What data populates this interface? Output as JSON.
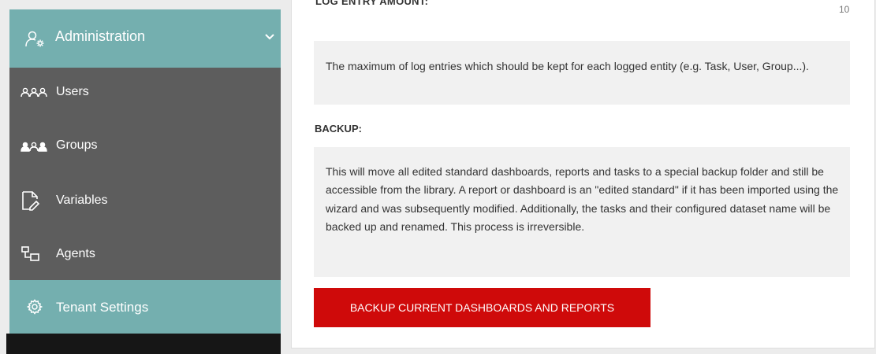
{
  "sidebar": {
    "admin": {
      "label": "Administration",
      "icon": "admin-settings-icon"
    },
    "items": [
      {
        "label": "Users",
        "icon": "users-icon"
      },
      {
        "label": "Groups",
        "icon": "groups-icon"
      },
      {
        "label": "Variables",
        "icon": "variables-icon"
      },
      {
        "label": "Agents",
        "icon": "agents-icon"
      }
    ],
    "tenant": {
      "label": "Tenant Settings",
      "icon": "gear-icon"
    }
  },
  "content": {
    "log_entry_amount_label": "LOG ENTRY AMOUNT:",
    "log_entry_amount_value": "10",
    "log_entry_description": "The maximum of log entries which should be kept for each logged entity (e.g. Task, User, Group...).",
    "backup_label": "BACKUP:",
    "backup_description": "This will move all edited standard dashboards, reports and tasks to a special backup folder and still be accessible from the library. A report or dashboard is an \"edited standard\" if it has been imported using the wizard and was subsequently modified. Additionally, the tasks and their configured dataset name will be backed up and renamed. This process is irreversible.",
    "backup_button_label": "BACKUP CURRENT DASHBOARDS AND REPORTS"
  },
  "colors": {
    "sidebar_active": "#74afaf",
    "sidebar_submenu": "#5d5d5d",
    "button_red": "#cf0a0a"
  }
}
